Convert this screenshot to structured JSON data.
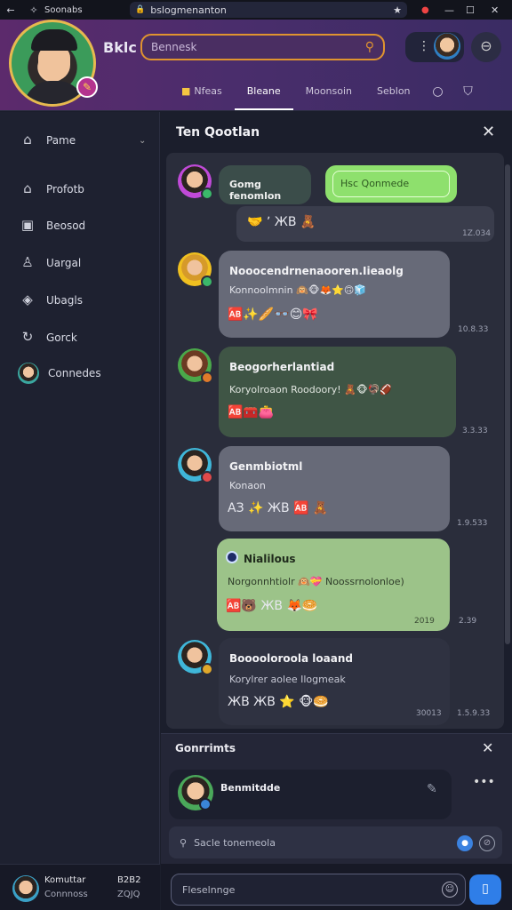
{
  "browser": {
    "tab_title": "Soonabs",
    "address": "bslogmenanton",
    "star_icon": "star-icon"
  },
  "header": {
    "logo": "Bklc",
    "search_placeholder": "Bennesk",
    "tabs": [
      {
        "label": "Nfeas"
      },
      {
        "label": "Bleane"
      },
      {
        "label": "Moonsoin"
      },
      {
        "label": "Seblon"
      }
    ]
  },
  "sidebar": {
    "items": [
      {
        "label": "Pame",
        "icon": "home-icon"
      },
      {
        "label": "Profotb",
        "icon": "home-icon"
      },
      {
        "label": "Beosod",
        "icon": "square-icon"
      },
      {
        "label": "Uargal",
        "icon": "user-icon"
      },
      {
        "label": "Ubagls",
        "icon": "tag-icon"
      },
      {
        "label": "Gorck",
        "icon": "refresh-icon"
      },
      {
        "label": "Connedes",
        "icon": "avatar"
      }
    ],
    "footer": {
      "name": "Komuttar",
      "status": "Connnoss",
      "time_top": "B2B2",
      "time_bottom": "ZQJQ"
    }
  },
  "thread": {
    "title": "Ten Qootlan",
    "messages": [
      {
        "name": "Gomg fenomlon",
        "text": "",
        "emoji": "",
        "ts": "",
        "pill": "Hsc Qonmede"
      },
      {
        "name": "",
        "text": "",
        "emoji": "🤝 ʼ ЖB 🧸",
        "ts": "1Z.034"
      },
      {
        "name": "Nooocendrnenaooren.Iieaolg",
        "text": "Konnoolmnin 🙉🐵🦊⭐🙃🧊",
        "emoji": "🆎✨🥖👓😊🎀",
        "ts": "10.8.33"
      },
      {
        "name": "Beogorherlantiad",
        "text": "Koryolroaon Roodoory! 🧸🐵🦃🏈",
        "emoji": "🆎🧰👛",
        "ts": "3.3.33"
      },
      {
        "name": "Genmbiotml",
        "text": "Konaon",
        "emoji": "AЗ ✨ ЖB 🆎 🧸",
        "ts": "1.9.533"
      },
      {
        "name": "Nialilous",
        "text": "Norgonnhtiolr 🙉💝 Noossrnolonloe)",
        "emoji": "🆎🐻 ЖB 🦊🥯",
        "ts": "2.39"
      },
      {
        "name": "Booooloroola loaand",
        "text": "Korylrer aolee Ilogmeak",
        "emoji": "ЖB ЖB ⭐ 🐵🥯",
        "ts": "1.5.9.33"
      }
    ],
    "inner_ts": [
      "2019",
      "30013"
    ]
  },
  "comments": {
    "title": "Gonrrimts",
    "author": "Benmitdde",
    "reply_placeholder": "Sacle tonemeola"
  },
  "composer": {
    "placeholder": "Fleselnnge"
  },
  "colors": {
    "header_gradient": "#5c2a6c",
    "search_border": "#e0942f",
    "green_pill": "#8ee06d",
    "green_bubble": "#3f5545",
    "send_button": "#2f7ee8"
  }
}
